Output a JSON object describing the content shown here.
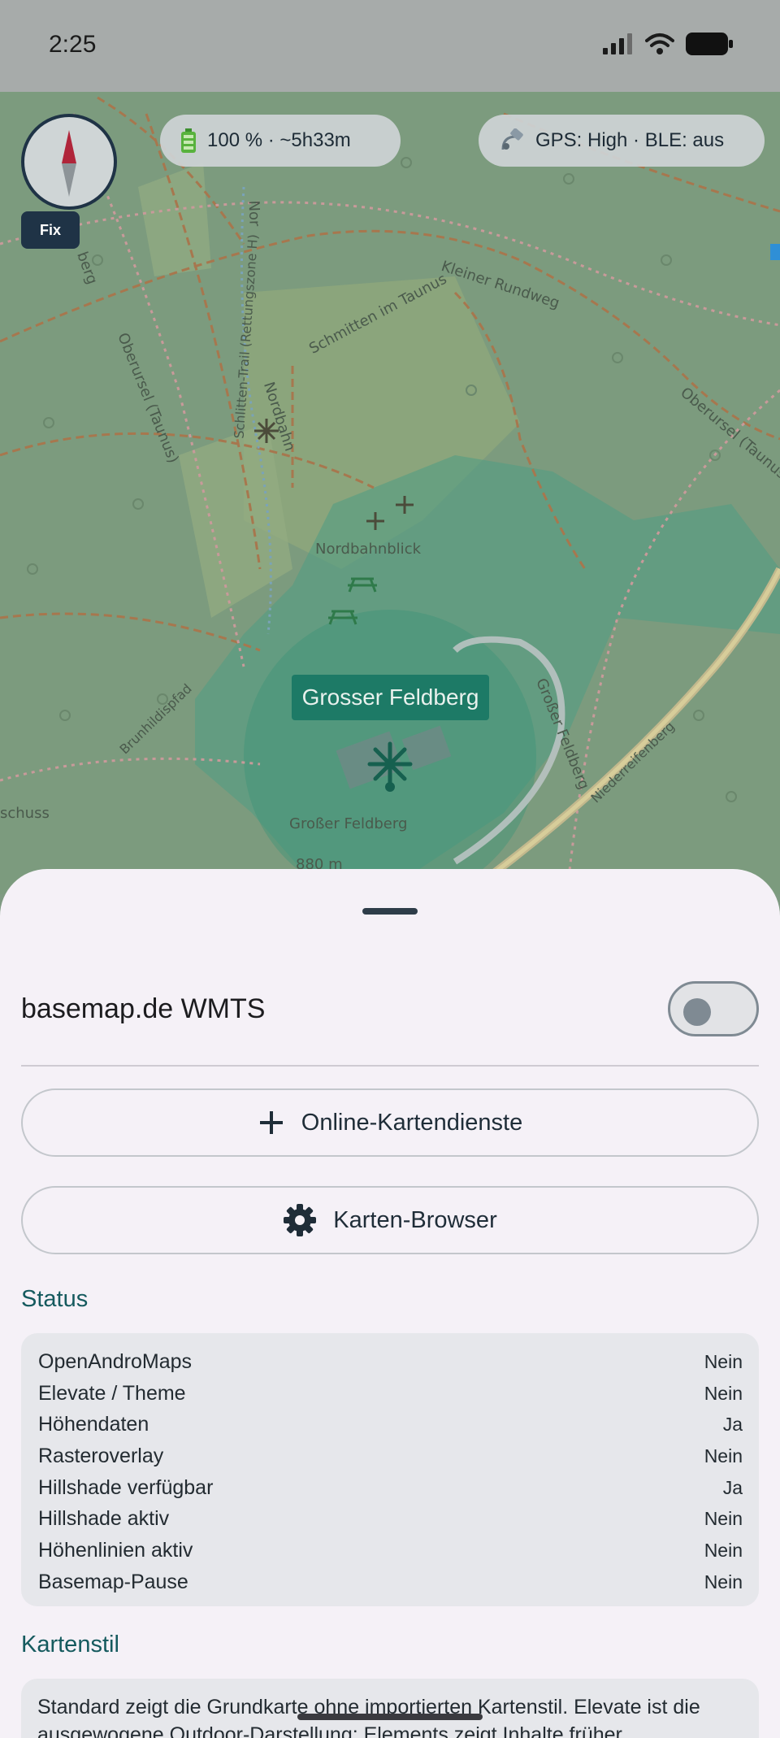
{
  "status_bar": {
    "time": "2:25"
  },
  "map": {
    "chips": {
      "battery": "100 % · ~5h33m",
      "gps": "GPS: High · BLE: aus"
    },
    "fix_label": "Fix",
    "place_label": "Grosser Feldberg",
    "labels": {
      "kleiner_rundweg": "Kleiner Rundweg",
      "schmitten": "Schmitten im Taunus",
      "oberursel_left": "Oberursel (Taunus)",
      "oberursel_right": "Oberursel (Taunus)",
      "schlitten_trail": "Schlitten-Trail (Rettungszone H)",
      "nordbahn": "Nordbahn",
      "nordbahnblick": "Nordbahnblick",
      "brunhildispfad": "Brunhildispfad",
      "grosser_feldberg_road": "Großer Feldberg",
      "niederreifenberg": "Niederreifenberg",
      "summit": "Großer Feldberg",
      "summit_elev": "880 m",
      "schuss": "schuss",
      "berg": "berg",
      "nor": "Nor"
    }
  },
  "sheet": {
    "wmts_label": "basemap.de WMTS",
    "wmts_enabled": false,
    "online_button": "Online-Kartendienste",
    "browser_button": "Karten-Browser",
    "status_title": "Status",
    "status_rows": [
      {
        "label": "OpenAndroMaps",
        "value": "Nein"
      },
      {
        "label": "Elevate / Theme",
        "value": "Nein"
      },
      {
        "label": "Höhendaten",
        "value": "Ja"
      },
      {
        "label": "Rasteroverlay",
        "value": "Nein"
      },
      {
        "label": "Hillshade verfügbar",
        "value": "Ja"
      },
      {
        "label": "Hillshade aktiv",
        "value": "Nein"
      },
      {
        "label": "Höhenlinien aktiv",
        "value": "Nein"
      },
      {
        "label": "Basemap-Pause",
        "value": "Nein"
      }
    ],
    "kartenstil_title": "Kartenstil",
    "kartenstil_text": "Standard zeigt die Grundkarte ohne importierten Kartenstil. Elevate ist die ausgewogene Outdoor-Darstellung; Elements zeigt Inhalte früher"
  }
}
